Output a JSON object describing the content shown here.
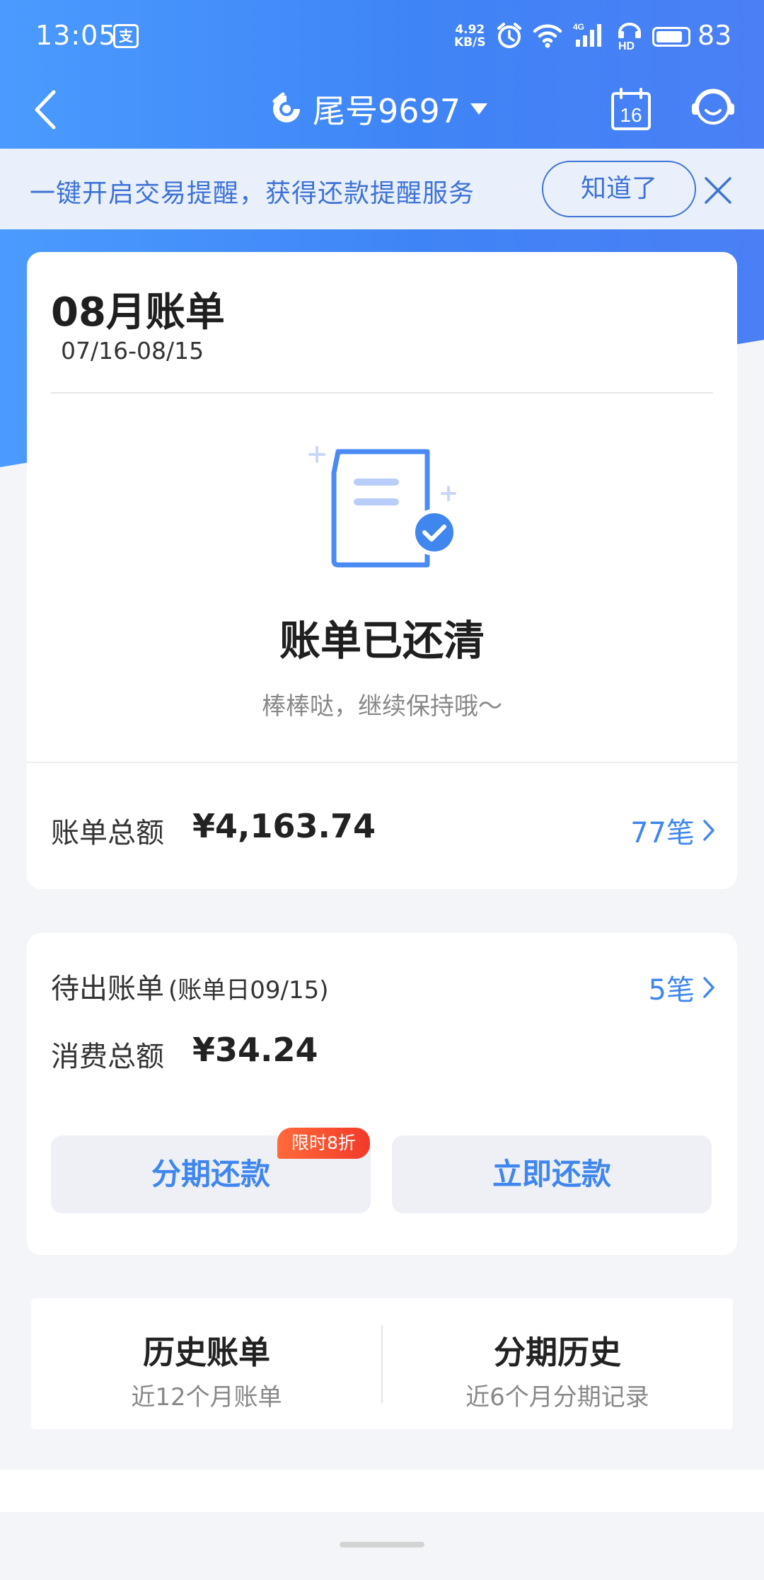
{
  "status_bar": {
    "time": "13:05",
    "app_badge": "支",
    "net_speed_value": "4.92",
    "net_speed_unit": "KB/S",
    "battery": "83",
    "icons": [
      "alarm-icon",
      "wifi-icon",
      "signal-4g-icon",
      "hd-call-icon",
      "battery-icon"
    ]
  },
  "nav": {
    "title": "尾号9697",
    "calendar_day": "16",
    "icons": [
      "back-icon",
      "bank-logo-icon",
      "dropdown-icon",
      "calendar-icon",
      "customer-service-icon"
    ]
  },
  "notice": {
    "text": "一键开启交易提醒，获得还款提醒服务",
    "button": "知道了"
  },
  "statement": {
    "month_title": "08月账单",
    "period": "07/16-08/15",
    "status_title": "账单已还清",
    "status_sub": "棒棒哒，继续保持哦～",
    "total_label": "账单总额",
    "total_amount": "¥4,163.74",
    "count_link": "77笔"
  },
  "pending": {
    "label": "待出账单",
    "bill_date": "(账单日09/15)",
    "count_link": "5笔",
    "spend_label": "消费总额",
    "spend_amount": "¥34.24",
    "installment_button": "分期还款",
    "promo_tag": "限时8折",
    "repay_button": "立即还款"
  },
  "shortcuts": {
    "history_title": "历史账单",
    "history_sub": "近12个月账单",
    "installment_title": "分期历史",
    "installment_sub": "近6个月分期记录"
  },
  "colors": {
    "primary_blue": "#3f86ee",
    "header_blue": "#4a8cf7",
    "promo_red": "#f23a2a"
  }
}
